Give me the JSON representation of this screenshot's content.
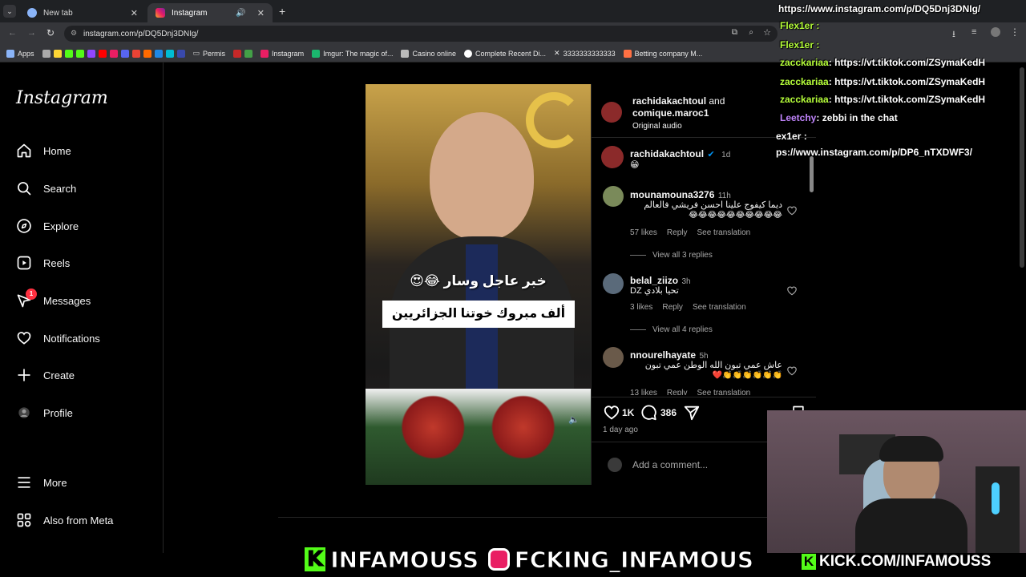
{
  "browser": {
    "tabs": [
      {
        "label": "New tab"
      },
      {
        "label": "Instagram"
      }
    ],
    "url": "instagram.com/p/DQ5Dnj3DNIg/",
    "bookmarks": [
      "Apps",
      "Permis",
      "Instagram",
      "Imgur: The magic of...",
      "Casino online",
      "Complete Recent Di...",
      "3333333333333",
      "Betting company M..."
    ]
  },
  "sidebar": {
    "logo": "Instagram",
    "items": [
      {
        "label": "Home",
        "icon": "home-icon"
      },
      {
        "label": "Search",
        "icon": "search-icon"
      },
      {
        "label": "Explore",
        "icon": "compass-icon"
      },
      {
        "label": "Reels",
        "icon": "reels-icon"
      },
      {
        "label": "Messages",
        "icon": "messenger-icon",
        "badge": "1"
      },
      {
        "label": "Notifications",
        "icon": "heart-icon"
      },
      {
        "label": "Create",
        "icon": "plus-icon"
      },
      {
        "label": "Profile",
        "icon": "avatar-icon"
      },
      {
        "label": "More",
        "icon": "menu-icon"
      },
      {
        "label": "Also from Meta",
        "icon": "meta-grid-icon"
      }
    ]
  },
  "post": {
    "header": {
      "user": "rachidakachtoul",
      "and": "and",
      "collab": "comique.maroc1",
      "audio": "Original audio"
    },
    "video": {
      "headline": "خبر عاجل وسار 😂😍",
      "caption_box": "ألف مبروك خوتنا الجزائريين"
    },
    "caption": {
      "user": "rachidakachtoul",
      "time": "1d",
      "text": "😁"
    },
    "comments": [
      {
        "user": "mounamouna3276",
        "time": "11h",
        "text": "ديما كيفوج علينا احسن فريشي فالعالم",
        "emoji": "😂😂😂😂😂😂😂😂😂😂",
        "likes": "57 likes",
        "reply": "Reply",
        "translate": "See translation",
        "view_replies": "View all 3 replies"
      },
      {
        "user": "belal_ziizo",
        "time": "3h",
        "text": "تحيا بلادي DZ",
        "emoji": "",
        "likes": "3 likes",
        "reply": "Reply",
        "translate": "See translation",
        "view_replies": "View all 4 replies"
      },
      {
        "user": "nnourelhayate",
        "time": "5h",
        "text": "عاش عمي تبون الله الوطن عمي تبون",
        "emoji": "❤️👏👏👏👏👏👏",
        "likes": "13 likes",
        "reply": "Reply",
        "translate": "See translation",
        "view_replies": ""
      }
    ],
    "actions": {
      "likes": "1K",
      "comments": "386",
      "date": "1 day ago",
      "add_comment_placeholder": "Add a comment..."
    }
  },
  "overlay": {
    "chat": [
      {
        "text": "https://www.instagram.com/p/DQ5Dnj3DNIg/"
      },
      {
        "user": "Flex1er :",
        "text": ""
      },
      {
        "user": "Flex1er :",
        "text": ""
      },
      {
        "user": "zaccka riaa",
        "text": ": https://vt.tiktok.com/ZSymaKedH"
      },
      {
        "user": "zacckariaa",
        "text": ": https://vt.tiktok.com/ZSymaKedH"
      },
      {
        "user": "zacckariaa",
        "text": ": https://vt.tiktok.com/ZSymaKedH"
      },
      {
        "user": "Leetchy",
        "text": ": zebbi in the chat"
      },
      {
        "user": "ex1er :",
        "text": ""
      },
      {
        "user": "",
        "text": "ps://www.instagram.com/p/DP6_nTXDWF3/"
      }
    ],
    "banner_kick": "INFAMOUSS",
    "banner_ig": "FCKING_INFAMOUS",
    "banner_site": "KICK.COM/INFAMOUSS",
    "kick_letter": "K"
  },
  "colors": {
    "accent": "#0095f6",
    "badge": "#ff3040",
    "kick": "#53fc18",
    "chat_user": "#b6ff3a"
  }
}
